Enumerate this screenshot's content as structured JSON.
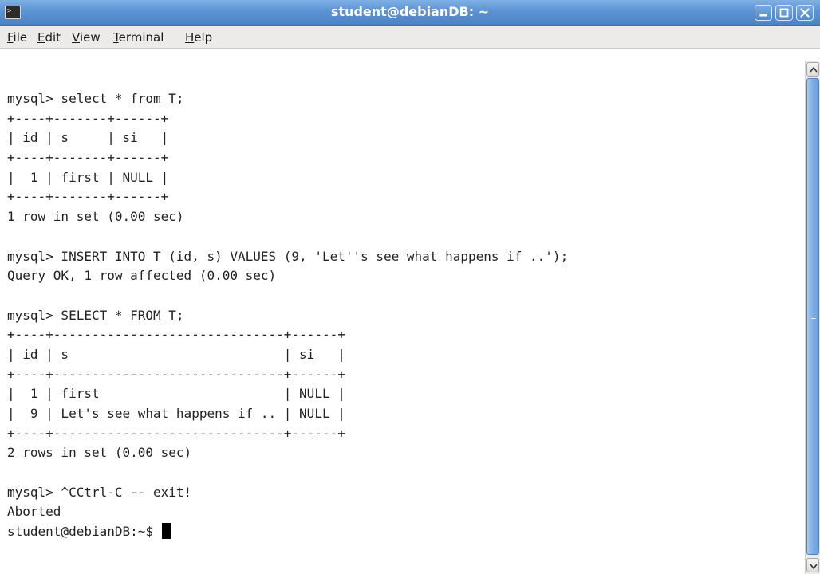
{
  "window": {
    "title": "student@debianDB: ~",
    "app_icon": "terminal-icon",
    "controls": {
      "minimize": "minimize-icon",
      "maximize": "maximize-icon",
      "close": "close-icon"
    },
    "accent_color": "#5b93d4"
  },
  "menubar": {
    "items": [
      {
        "mnemonic": "F",
        "rest": "ile"
      },
      {
        "mnemonic": "E",
        "rest": "dit"
      },
      {
        "mnemonic": "V",
        "rest": "iew"
      },
      {
        "mnemonic": "T",
        "rest": "erminal"
      },
      {
        "mnemonic": "H",
        "rest": "elp"
      }
    ]
  },
  "terminal": {
    "lines": [
      "mysql> select * from T;",
      "+----+-------+------+",
      "| id | s     | si   |",
      "+----+-------+------+",
      "|  1 | first | NULL |",
      "+----+-------+------+",
      "1 row in set (0.00 sec)",
      "",
      "mysql> INSERT INTO T (id, s) VALUES (9, 'Let''s see what happens if ..');",
      "Query OK, 1 row affected (0.00 sec)",
      "",
      "mysql> SELECT * FROM T;",
      "+----+------------------------------+------+",
      "| id | s                            | si   |",
      "+----+------------------------------+------+",
      "|  1 | first                        | NULL |",
      "|  9 | Let's see what happens if .. | NULL |",
      "+----+------------------------------+------+",
      "2 rows in set (0.00 sec)",
      "",
      "mysql> ^CCtrl-C -- exit!",
      "Aborted"
    ],
    "prompt": "student@debianDB:~$ "
  },
  "scrollbar": {
    "up_icon": "scroll-up-arrow-icon",
    "down_icon": "scroll-down-arrow-icon"
  }
}
